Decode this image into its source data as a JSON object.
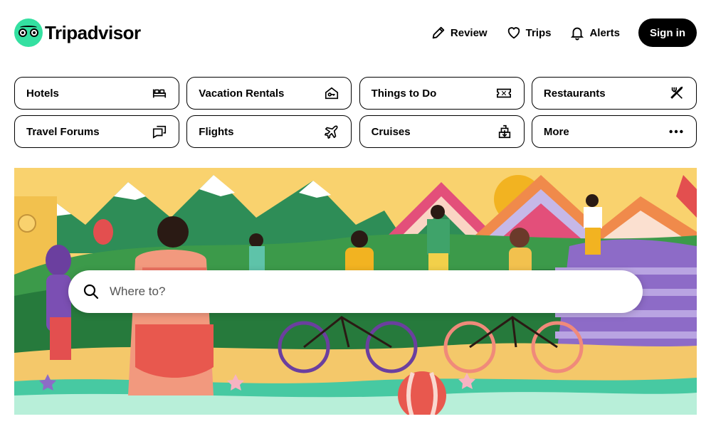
{
  "brand": {
    "name": "Tripadvisor",
    "accent": "#34e0a1"
  },
  "nav": {
    "review": "Review",
    "trips": "Trips",
    "alerts": "Alerts",
    "sign_in": "Sign in"
  },
  "categories": [
    {
      "label": "Hotels",
      "icon": "bed-icon"
    },
    {
      "label": "Vacation Rentals",
      "icon": "house-key-icon"
    },
    {
      "label": "Things to Do",
      "icon": "ticket-icon"
    },
    {
      "label": "Restaurants",
      "icon": "fork-knife-icon"
    },
    {
      "label": "Travel Forums",
      "icon": "chat-bubbles-icon"
    },
    {
      "label": "Flights",
      "icon": "airplane-icon"
    },
    {
      "label": "Cruises",
      "icon": "ship-icon"
    },
    {
      "label": "More",
      "icon": "more-dots-icon"
    }
  ],
  "search": {
    "placeholder": "Where to?",
    "value": ""
  }
}
